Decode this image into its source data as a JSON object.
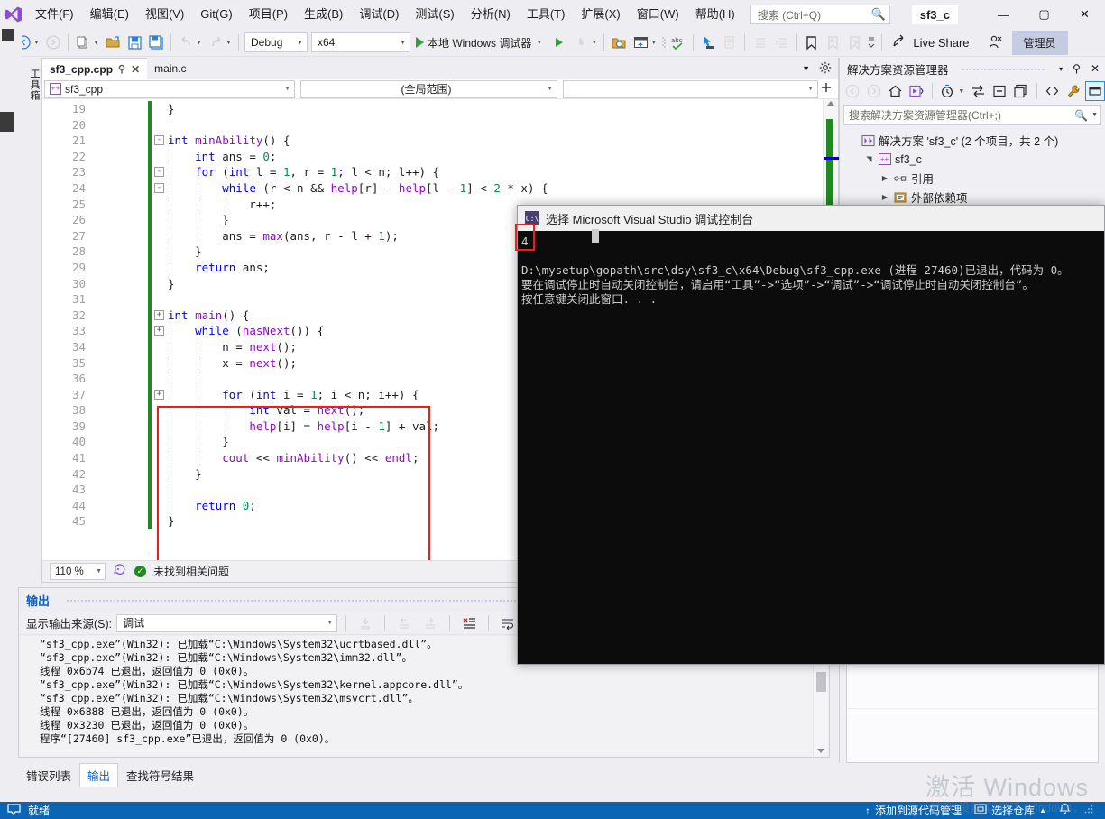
{
  "window": {
    "project_badge": "sf3_c",
    "minimize": "—",
    "maximize": "▢",
    "close": "✕"
  },
  "menu": {
    "items": [
      {
        "label": "文件(F)",
        "name": "menu-file"
      },
      {
        "label": "编辑(E)",
        "name": "menu-edit"
      },
      {
        "label": "视图(V)",
        "name": "menu-view"
      },
      {
        "label": "Git(G)",
        "name": "menu-git"
      },
      {
        "label": "项目(P)",
        "name": "menu-project"
      },
      {
        "label": "生成(B)",
        "name": "menu-build"
      },
      {
        "label": "调试(D)",
        "name": "menu-debug"
      },
      {
        "label": "测试(S)",
        "name": "menu-test"
      },
      {
        "label": "分析(N)",
        "name": "menu-analyze"
      },
      {
        "label": "工具(T)",
        "name": "menu-tools"
      },
      {
        "label": "扩展(X)",
        "name": "menu-extensions"
      },
      {
        "label": "窗口(W)",
        "name": "menu-window"
      },
      {
        "label": "帮助(H)",
        "name": "menu-help"
      }
    ]
  },
  "search": {
    "placeholder": "搜索 (Ctrl+Q)",
    "value": "",
    "icon": "search-icon"
  },
  "toolbar": {
    "config": "Debug",
    "platform": "x64",
    "run_label": "本地 Windows 调试器",
    "live_share": "Live Share",
    "admin_badge": "管理员"
  },
  "toolbox_tab": "工具箱",
  "editor": {
    "tabs": [
      {
        "label": "sf3_cpp.cpp",
        "active": true,
        "pin": "⚲",
        "close": "✕"
      },
      {
        "label": "main.c",
        "active": false
      }
    ],
    "nav_project": "sf3_cpp",
    "nav_scope": "(全局范围)",
    "nav_member": "",
    "zoom": "110 %",
    "status_text": "未找到相关问题",
    "lines": [
      {
        "n": "19",
        "fold": "",
        "indent": 1,
        "text": "}"
      },
      {
        "n": "20",
        "fold": "",
        "indent": 0,
        "text": ""
      },
      {
        "n": "21",
        "fold": "-",
        "indent": 0,
        "text": "int minAbility() {"
      },
      {
        "n": "22",
        "fold": "",
        "indent": 1,
        "text": "    int ans = 0;"
      },
      {
        "n": "23",
        "fold": "-",
        "indent": 1,
        "text": "    for (int l = 1, r = 1; l < n; l++) {"
      },
      {
        "n": "24",
        "fold": "-",
        "indent": 2,
        "text": "        while (r < n && help[r] - help[l - 1] < 2 * x) {"
      },
      {
        "n": "25",
        "fold": "",
        "indent": 3,
        "text": "            r++;"
      },
      {
        "n": "26",
        "fold": "",
        "indent": 2,
        "text": "        }"
      },
      {
        "n": "27",
        "fold": "",
        "indent": 2,
        "text": "        ans = max(ans, r - l + 1);"
      },
      {
        "n": "28",
        "fold": "",
        "indent": 1,
        "text": "    }"
      },
      {
        "n": "29",
        "fold": "",
        "indent": 1,
        "text": "    return ans;"
      },
      {
        "n": "30",
        "fold": "",
        "indent": 0,
        "text": "}"
      },
      {
        "n": "31",
        "fold": "",
        "indent": 0,
        "text": ""
      },
      {
        "n": "32",
        "fold": "+",
        "indent": 0,
        "text": "int main() {"
      },
      {
        "n": "33",
        "fold": "+",
        "indent": 1,
        "text": "    while (hasNext()) {"
      },
      {
        "n": "34",
        "fold": "",
        "indent": 2,
        "text": "        n = next();"
      },
      {
        "n": "35",
        "fold": "",
        "indent": 2,
        "text": "        x = next();"
      },
      {
        "n": "36",
        "fold": "",
        "indent": 2,
        "text": ""
      },
      {
        "n": "37",
        "fold": "+",
        "indent": 2,
        "text": "        for (int i = 1; i < n; i++) {"
      },
      {
        "n": "38",
        "fold": "",
        "indent": 3,
        "text": "            int val = next();"
      },
      {
        "n": "39",
        "fold": "",
        "indent": 3,
        "text": "            help[i] = help[i - 1] + val;"
      },
      {
        "n": "40",
        "fold": "",
        "indent": 2,
        "text": "        }"
      },
      {
        "n": "41",
        "fold": "",
        "indent": 2,
        "text": "        cout << minAbility() << endl;"
      },
      {
        "n": "42",
        "fold": "",
        "indent": 1,
        "text": "    }"
      },
      {
        "n": "43",
        "fold": "",
        "indent": 1,
        "text": ""
      },
      {
        "n": "44",
        "fold": "",
        "indent": 1,
        "text": "    return 0;"
      },
      {
        "n": "45",
        "fold": "",
        "indent": 0,
        "text": "}"
      }
    ]
  },
  "output": {
    "title": "输出",
    "source_label": "显示输出来源(S):",
    "source_value": "调试",
    "lines": [
      "“sf3_cpp.exe”(Win32): 已加载“C:\\Windows\\System32\\ucrtbased.dll”。",
      "“sf3_cpp.exe”(Win32): 已加载“C:\\Windows\\System32\\imm32.dll”。",
      "线程 0x6b74 已退出，返回值为 0 (0x0)。",
      "“sf3_cpp.exe”(Win32): 已加载“C:\\Windows\\System32\\kernel.appcore.dll”。",
      "“sf3_cpp.exe”(Win32): 已加载“C:\\Windows\\System32\\msvcrt.dll”。",
      "线程 0x6888 已退出，返回值为 0 (0x0)。",
      "线程 0x3230 已退出，返回值为 0 (0x0)。",
      "程序“[27460] sf3_cpp.exe”已退出，返回值为 0 (0x0)。"
    ]
  },
  "bottom_tabs": [
    {
      "label": "错误列表",
      "active": false
    },
    {
      "label": "输出",
      "active": true
    },
    {
      "label": "查找符号结果",
      "active": false
    }
  ],
  "solution_explorer": {
    "title": "解决方案资源管理器",
    "search_placeholder": "搜索解决方案资源管理器(Ctrl+;)",
    "tree": [
      {
        "label": "解决方案 'sf3_c' (2 个项目，共 2 个)",
        "arrow": "",
        "depth": 0,
        "icon": "solution-icon"
      },
      {
        "label": "sf3_c",
        "arrow": "▲",
        "depth": 1,
        "icon": "cpp-project-icon"
      },
      {
        "label": "引用",
        "arrow": "▶",
        "depth": 2,
        "icon": "references-icon"
      },
      {
        "label": "外部依赖项",
        "arrow": "▶",
        "depth": 2,
        "icon": "external-deps-icon"
      }
    ],
    "pin": "⚲",
    "close": "✕",
    "caret": "▾"
  },
  "console": {
    "title": "选择 Microsoft Visual Studio 调试控制台",
    "icon_label": "C:\\",
    "program_output": "4",
    "lines": [
      "",
      "D:\\mysetup\\gopath\\src\\dsy\\sf3_c\\x64\\Debug\\sf3_cpp.exe (进程 27460)已退出，代码为 0。",
      "要在调试停止时自动关闭控制台，请启用“工具”->“选项”->“调试”->“调试停止时自动关闭控制台”。",
      "按任意键关闭此窗口. . ."
    ]
  },
  "statusbar": {
    "ready": "就绪",
    "source_control": "添加到源代码管理",
    "repo": "选择仓库",
    "bell": "🔔"
  },
  "watermark": {
    "line1": "激活 Windows",
    "line2": "转到\"设置\"以激活 Windows。"
  },
  "colors": {
    "accent": "#0a65b5",
    "chrome": "#eeeef2",
    "editor_bg": "#ffffff",
    "console_bg": "#0c0c0c",
    "highlight_red": "#f01d1d",
    "change_green": "#1f8a1f"
  }
}
